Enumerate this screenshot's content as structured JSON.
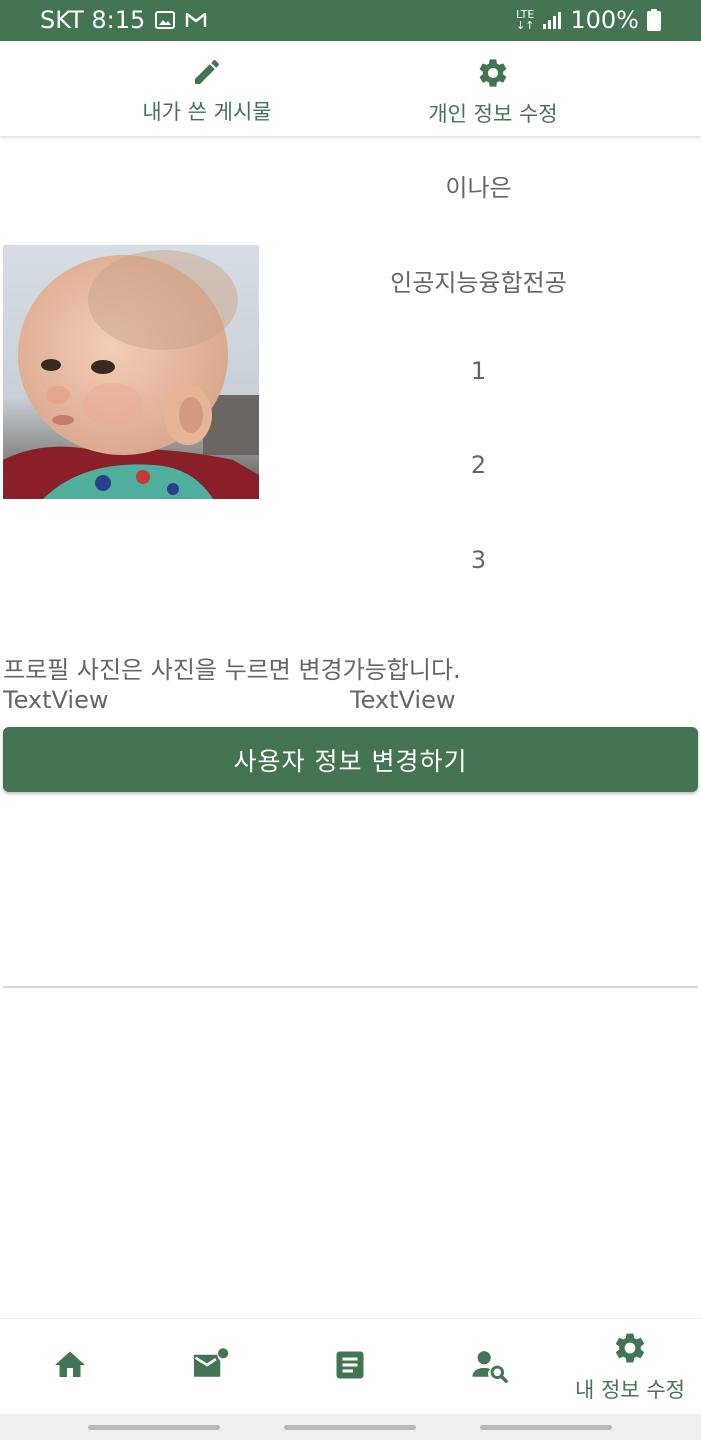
{
  "status_bar": {
    "carrier_time": "SKT 8:15",
    "network": "LTE",
    "battery": "100%"
  },
  "top_tabs": [
    {
      "label": "내가 쓴 게시물",
      "icon": "pencil-icon"
    },
    {
      "label": "개인 정보 수정",
      "icon": "gear-icon"
    }
  ],
  "profile": {
    "name": "이나은",
    "major": "인공지능융합전공",
    "stat1": "1",
    "stat2": "2",
    "stat3": "3",
    "hint": "프로필 사진은 사진을 누르면 변경가능합니다.",
    "textview1": "TextView",
    "textview2": "TextView"
  },
  "change_button": {
    "label": "사용자 정보 변경하기"
  },
  "bottom_nav": [
    {
      "icon": "home-icon",
      "label": ""
    },
    {
      "icon": "mail-icon",
      "label": ""
    },
    {
      "icon": "document-icon",
      "label": ""
    },
    {
      "icon": "person-search-icon",
      "label": ""
    },
    {
      "icon": "gear-icon",
      "label": "내 정보 수정"
    }
  ],
  "colors": {
    "primary": "#437553",
    "text_gray": "#666666"
  }
}
